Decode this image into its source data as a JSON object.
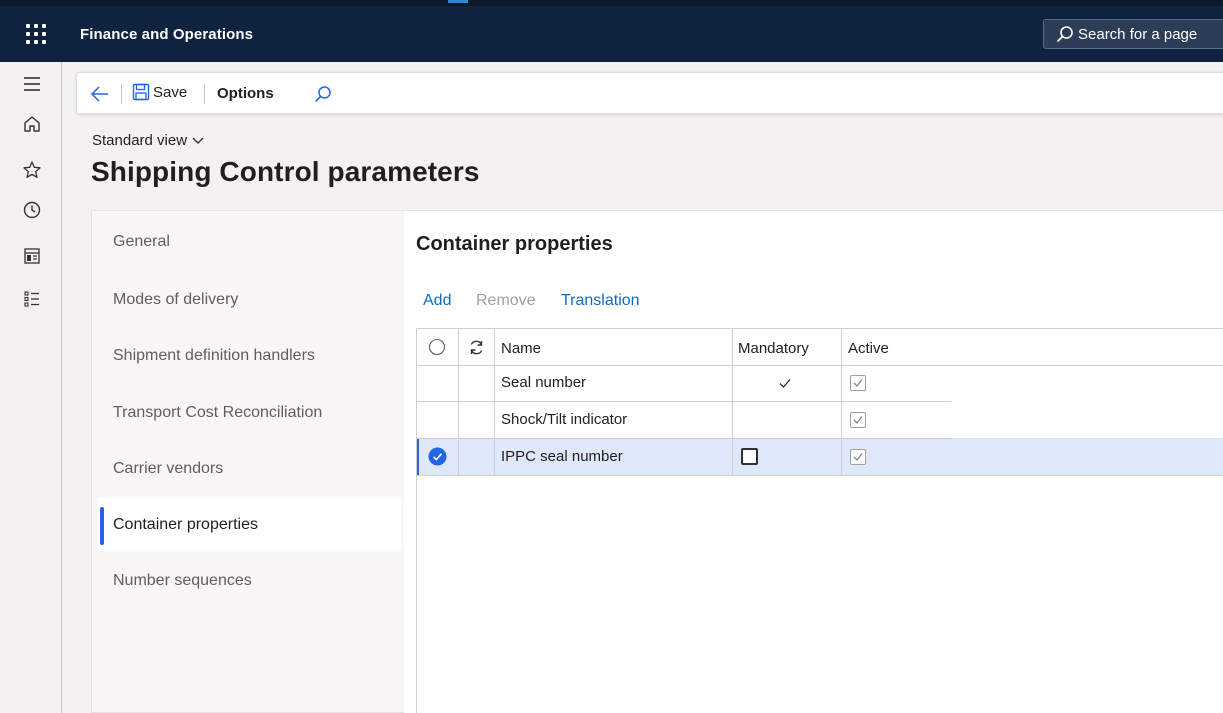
{
  "app": {
    "title": "Finance and Operations"
  },
  "search": {
    "placeholder": "Search for a page"
  },
  "rail": {
    "icons": [
      "hamburger-icon",
      "home-icon",
      "star-icon",
      "clock-icon",
      "workspace-icon",
      "modules-icon"
    ]
  },
  "action_pane": {
    "save_label": "Save",
    "options_label": "Options"
  },
  "view": {
    "label": "Standard view"
  },
  "page": {
    "title": "Shipping Control parameters"
  },
  "nav": {
    "items": [
      {
        "label": "General"
      },
      {
        "label": "Modes of delivery"
      },
      {
        "label": "Shipment definition handlers"
      },
      {
        "label": "Transport Cost Reconciliation"
      },
      {
        "label": "Carrier vendors"
      },
      {
        "label": "Container properties",
        "selected": true
      },
      {
        "label": "Number sequences"
      }
    ]
  },
  "section": {
    "title": "Container properties"
  },
  "grid_actions": {
    "add": "Add",
    "remove": "Remove",
    "translation": "Translation"
  },
  "grid": {
    "columns": {
      "name": "Name",
      "mandatory": "Mandatory",
      "active": "Active"
    },
    "rows": [
      {
        "name": "Seal number",
        "mandatory": true,
        "active": true,
        "selected": false
      },
      {
        "name": "Shock/Tilt indicator",
        "mandatory": false,
        "active": true,
        "selected": false
      },
      {
        "name": "IPPC seal number",
        "mandatory": false,
        "active": true,
        "selected": true
      }
    ]
  },
  "colors": {
    "header_bg": "#0f2240",
    "accent": "#2266e3",
    "link": "#0f6cbd",
    "selected_row": "#dfe8f9"
  }
}
